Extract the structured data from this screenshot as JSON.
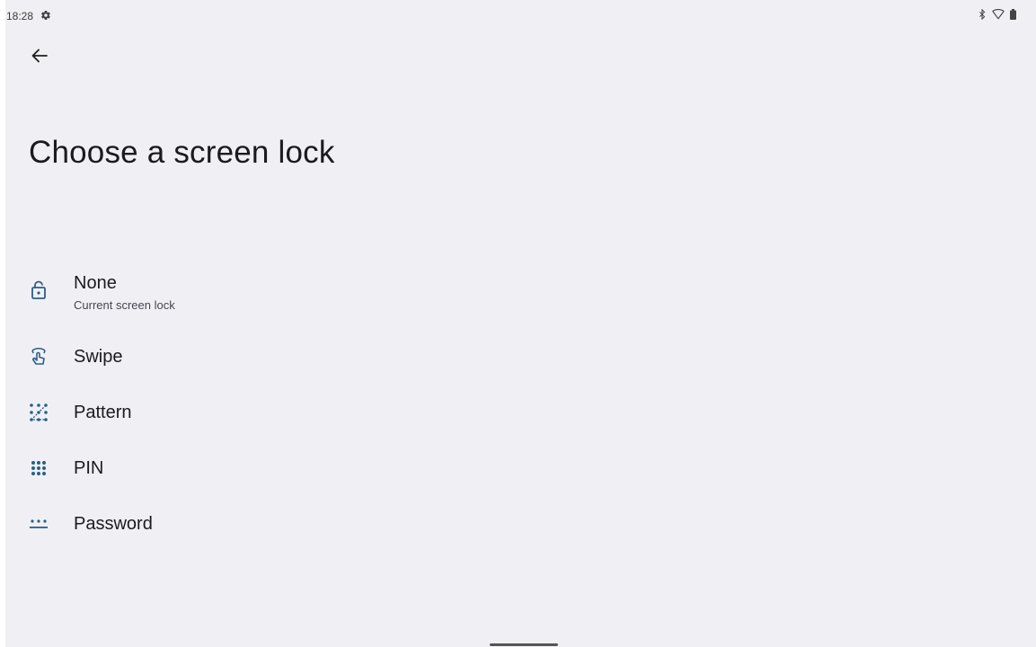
{
  "status_bar": {
    "time": "18:28",
    "icons": [
      "settings-icon",
      "bluetooth-icon",
      "wifi-icon",
      "battery-icon"
    ]
  },
  "header": {
    "back_icon": "arrow-left-icon",
    "title": "Choose a screen lock"
  },
  "options": [
    {
      "label": "None",
      "sublabel": "Current screen lock",
      "icon": "lock-open-icon"
    },
    {
      "label": "Swipe",
      "icon": "swipe-icon"
    },
    {
      "label": "Pattern",
      "icon": "pattern-icon"
    },
    {
      "label": "PIN",
      "icon": "pin-icon"
    },
    {
      "label": "Password",
      "icon": "password-icon"
    }
  ],
  "colors": {
    "background": "#f0f0f4",
    "icon_accent": "#2a5f86",
    "text_primary": "#1b1b1f"
  }
}
